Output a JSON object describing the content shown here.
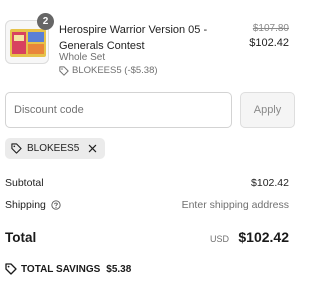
{
  "line_item": {
    "quantity_badge": "2",
    "title": "Herospire Warrior Version 05 - Generals Contest",
    "variant": "Whole Set",
    "discount_note": "BLOKEES5 (-$5.38)",
    "original_price": "$107.80",
    "price": "$102.42"
  },
  "discount_form": {
    "placeholder": "Discount code",
    "value": "",
    "apply_label": "Apply"
  },
  "applied_codes": [
    {
      "code": "BLOKEES5"
    }
  ],
  "summary": {
    "subtotal_label": "Subtotal",
    "subtotal_value": "$102.42",
    "shipping_label": "Shipping",
    "shipping_value": "Enter shipping address",
    "total_label": "Total",
    "currency": "USD",
    "total_value": "$102.42",
    "savings_label": "TOTAL SAVINGS",
    "savings_value": "$5.38"
  },
  "icons": {
    "tag": "tag-icon",
    "remove": "close-icon",
    "help": "question-circle-icon"
  },
  "colors": {
    "badge": "#666666",
    "chip_background": "#ebebeb",
    "muted_text": "#707070",
    "apply_background": "#f5f5f5"
  }
}
